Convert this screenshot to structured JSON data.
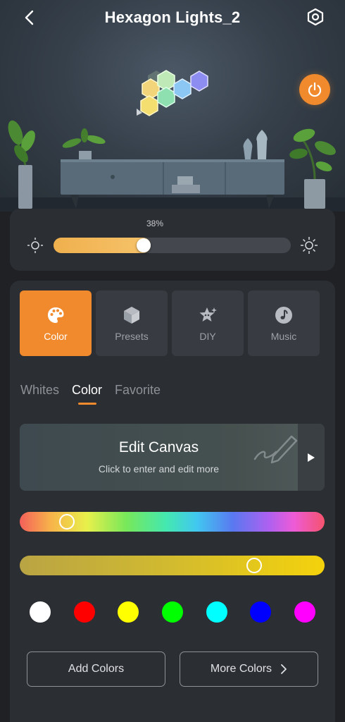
{
  "header": {
    "title": "Hexagon Lights_2"
  },
  "icons": {
    "back": "chevron-left-icon",
    "settings": "hexagon-settings-icon",
    "power": "power-icon",
    "brightness_low": "sun-low-icon",
    "brightness_high": "sun-high-icon",
    "canvas_arrow": "play-right-icon",
    "more_arrow": "chevron-right-icon"
  },
  "colors": {
    "accent": "#f08a2c",
    "panel": "#2b2e33",
    "background": "#1f2124"
  },
  "brightness": {
    "label": "38%",
    "value": 0.38
  },
  "modes": [
    {
      "label": "Color",
      "icon": "palette-icon",
      "active": true
    },
    {
      "label": "Presets",
      "icon": "cube-icon",
      "active": false
    },
    {
      "label": "DIY",
      "icon": "star-sparkle-icon",
      "active": false
    },
    {
      "label": "Music",
      "icon": "music-note-icon",
      "active": false
    }
  ],
  "tabs": [
    {
      "label": "Whites",
      "active": false
    },
    {
      "label": "Color",
      "active": true
    },
    {
      "label": "Favorite",
      "active": false
    }
  ],
  "canvas": {
    "title": "Edit Canvas",
    "subtitle": "Click to enter and edit more"
  },
  "hue_slider": {
    "value": 0.155
  },
  "saturation_slider": {
    "value": 0.77
  },
  "swatches": [
    "#ffffff",
    "#ff0000",
    "#ffff00",
    "#00ff00",
    "#00ffff",
    "#0000ff",
    "#ff00ff"
  ],
  "buttons": {
    "add_colors": "Add Colors",
    "more_colors": "More Colors"
  }
}
